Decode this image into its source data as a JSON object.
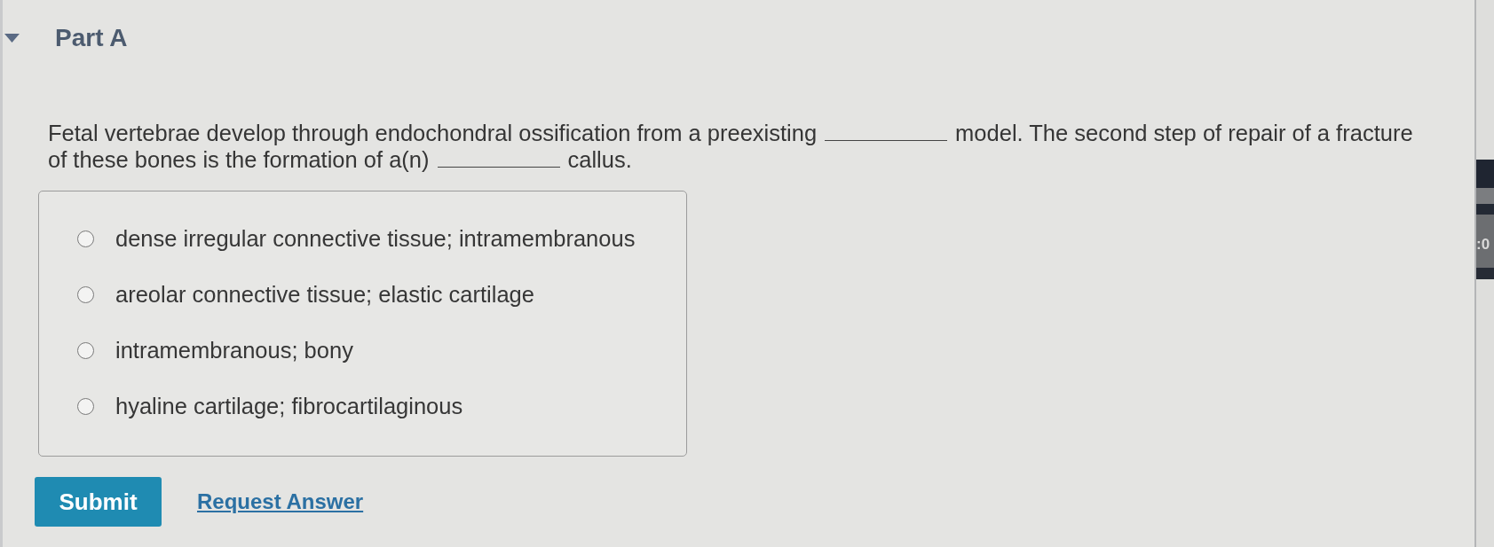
{
  "part": {
    "title": "Part A",
    "expanded": true
  },
  "question": {
    "lines": [
      [
        {
          "kind": "text",
          "text": "Fetal vertebrae develop through endochondral ossification from a preexisting"
        },
        {
          "kind": "blank"
        },
        {
          "kind": "text",
          "text": "model. The second step of repair of a fracture"
        }
      ],
      [
        {
          "kind": "text",
          "text": "of these bones is the formation of a(n)"
        },
        {
          "kind": "blank"
        },
        {
          "kind": "text",
          "text": "callus."
        }
      ]
    ]
  },
  "choices": [
    {
      "label": "dense irregular connective tissue; intramembranous",
      "selected": false
    },
    {
      "label": "areolar connective tissue; elastic cartilage",
      "selected": false
    },
    {
      "label": "intramembranous; bony",
      "selected": false
    },
    {
      "label": "hyaline cartilage; fibrocartilaginous",
      "selected": false
    }
  ],
  "actions": {
    "submit": "Submit",
    "request_answer": "Request Answer"
  },
  "side_panel": {
    "text": ":0"
  }
}
